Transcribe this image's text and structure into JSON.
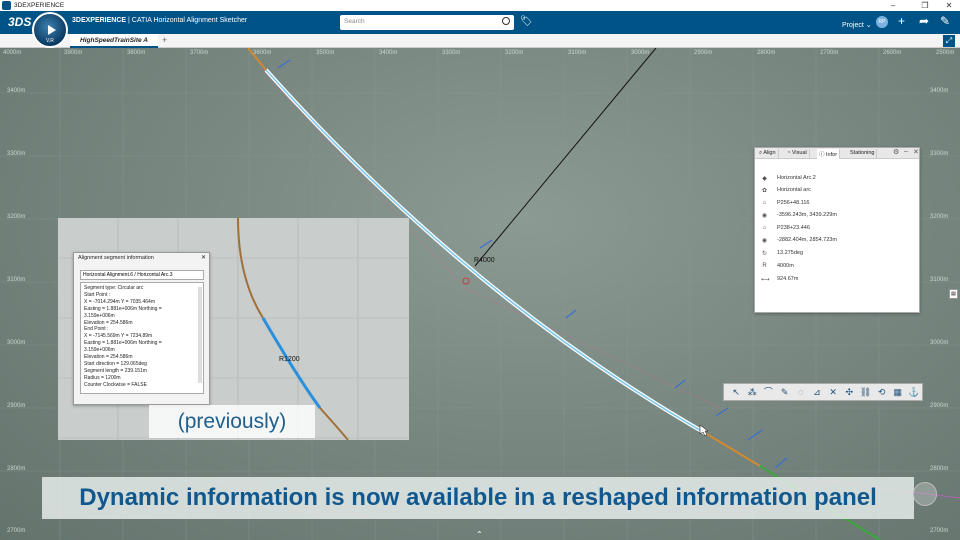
{
  "window": {
    "title": "3DEXPERIENCE"
  },
  "header": {
    "brand": "3DEXPERIENCE",
    "app": "CATIA Horizontal Alignment Sketcher",
    "search_placeholder": "Search",
    "project": "Project",
    "avatar": "RP",
    "compass_version": "V,R"
  },
  "tabs": {
    "active": "HighSpeedTrainSite A",
    "add": "+"
  },
  "axes": {
    "x_labels": [
      "4000m",
      "3900m",
      "3800m",
      "3700m",
      "3600m",
      "3500m",
      "3400m",
      "3300m",
      "3200m",
      "3100m",
      "3000m",
      "2900m",
      "2800m",
      "2700m",
      "2600m",
      "2500m"
    ],
    "y_labels_left": [
      "3400m",
      "3300m",
      "3200m",
      "3100m",
      "3000m",
      "2900m",
      "2800m",
      "2700m"
    ],
    "y_labels_right": [
      "3400m",
      "3300m",
      "3200m",
      "3100m",
      "3000m",
      "2900m",
      "2800m",
      "2700m"
    ]
  },
  "canvas": {
    "radius_label": "R4000",
    "inset_radius_label": "R1200"
  },
  "info_panel": {
    "tabs": [
      "Align",
      "Visual",
      "Infor",
      "Stationing"
    ],
    "rows": [
      {
        "icon": "tag-icon",
        "value": "Horizontal Arc.2"
      },
      {
        "icon": "type-icon",
        "value": "Horizontal arc"
      },
      {
        "icon": "start-station-icon",
        "value": "P256+48.116"
      },
      {
        "icon": "start-point-icon",
        "value": "-3596.243m, 3439.229m"
      },
      {
        "icon": "end-station-icon",
        "value": "P238+23.446"
      },
      {
        "icon": "end-point-icon",
        "value": "-2882.404m, 2854.723m"
      },
      {
        "icon": "angle-icon",
        "value": "13.275deg"
      },
      {
        "icon": "radius-icon",
        "value": "4000m"
      },
      {
        "icon": "length-icon",
        "value": "924.67m"
      }
    ]
  },
  "toolbar": {
    "tools": [
      "select-tool",
      "point-tool",
      "arc-tool",
      "pen-tool",
      "circle-tool",
      "line-tool",
      "cross-tool",
      "snap-tool",
      "constraint-tool",
      "measure-tool",
      "table-tool",
      "anchor-tool"
    ]
  },
  "dialog": {
    "title": "Alignment segment information",
    "selection": "Horizontal Alignment.6 / Horizontal Arc.3",
    "lines": [
      "Segment type: Circular arc",
      "Start Point :",
      "   X = -7014.294m Y = 7035.464m",
      "   Easting = 1.881e+006m Northing =",
      "3.159e+006m",
      "   Elevation = 254.586m",
      "End Point :",
      "   X = -7145.569m Y = 7234.89m",
      "   Easting = 1.881e+006m Northing =",
      "3.159e+006m",
      "   Elevation = 254.586m",
      "Start direction = 129.065deg",
      "Segment length = 239.151m",
      "Radius = 1200m",
      "Counter Clockwise = FALSE"
    ]
  },
  "labels": {
    "previously": "(previously)",
    "caption": "Dynamic information is now available in a reshaped information panel"
  }
}
